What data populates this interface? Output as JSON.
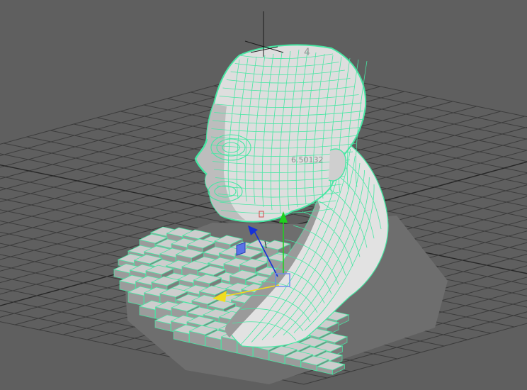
{
  "viewport": {
    "name": "perspective-viewport",
    "background_color": "#5f5f5f",
    "grid_color": "#3c3c3c",
    "grid_axis_color": "#262626",
    "wireframe_color": "#46e7a3",
    "shaded_color": "#cfcfcf",
    "selection_highlight": "on"
  },
  "hud": {
    "manipulator_readout": "6.50132",
    "vertex_label": "4"
  },
  "manipulator": {
    "type": "move-tool",
    "x_axis_color": "#f0dc1e",
    "y_axis_color": "#1fd11f",
    "z_axis_color": "#1530d8",
    "plane_handle_color": "#6a8cf0"
  },
  "scene_objects": [
    {
      "label": "head-bust-mesh",
      "selected": true
    },
    {
      "label": "stepped-base-mesh",
      "selected": false
    },
    {
      "label": "shoulder-shell-mesh",
      "selected": false
    }
  ]
}
